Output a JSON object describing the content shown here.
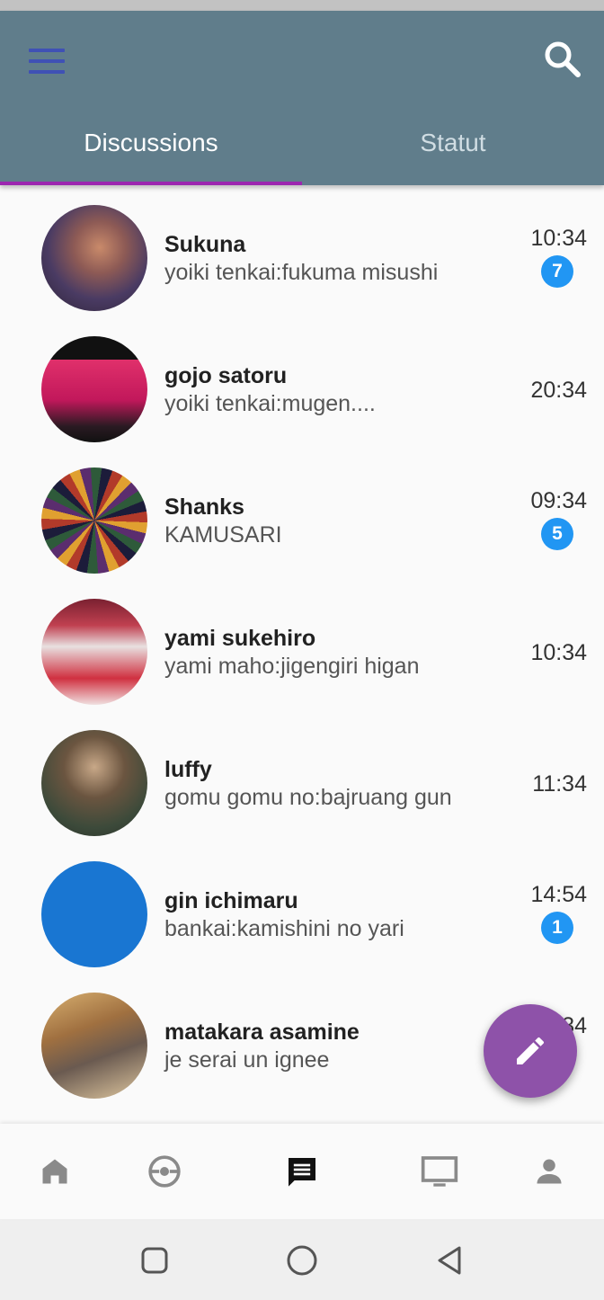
{
  "header": {
    "menu_icon": "hamburger-menu-icon",
    "search_icon": "search-icon",
    "tabs": [
      {
        "label": "Discussions",
        "active": true
      },
      {
        "label": "Statut",
        "active": false
      }
    ],
    "colors": {
      "appbar": "#607d8b",
      "tab_indicator": "#9c27b0",
      "menu_icon": "#3f51b5"
    }
  },
  "chats": [
    {
      "name": "Sukuna",
      "message": "yoiki tenkai:fukuma misushi",
      "time": "10:34",
      "unread": "7"
    },
    {
      "name": "gojo satoru",
      "message": "yoiki tenkai:mugen....",
      "time": "20:34",
      "unread": null
    },
    {
      "name": "Shanks",
      "message": "KAMUSARI",
      "time": "09:34",
      "unread": "5"
    },
    {
      "name": "yami sukehiro",
      "message": "yami maho:jigengiri higan",
      "time": "10:34",
      "unread": null
    },
    {
      "name": "luffy",
      "message": "gomu gomu no:bajruang gun",
      "time": "11:34",
      "unread": null
    },
    {
      "name": "gin ichimaru",
      "message": "bankai:kamishini no yari",
      "time": "14:54",
      "unread": "1"
    },
    {
      "name": "matakara asamine",
      "message": "je serai un ignee",
      "time": "34",
      "unread": null
    }
  ],
  "fab": {
    "icon": "pencil-edit-icon",
    "color": "#8e52a9"
  },
  "bottom_nav": [
    {
      "icon": "home-icon",
      "active": false
    },
    {
      "icon": "pokeball-icon",
      "active": false
    },
    {
      "icon": "chat-icon",
      "active": true
    },
    {
      "icon": "tv-icon",
      "active": false
    },
    {
      "icon": "person-icon",
      "active": false
    }
  ],
  "system_nav": [
    {
      "icon": "recents-square-icon"
    },
    {
      "icon": "home-circle-icon"
    },
    {
      "icon": "back-triangle-icon"
    }
  ],
  "colors": {
    "badge": "#2196f3",
    "avatar_placeholder": "#1976d2"
  }
}
